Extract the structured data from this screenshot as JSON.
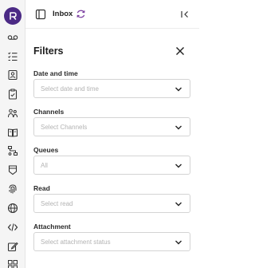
{
  "header": {
    "title": "Inbox"
  },
  "filters": {
    "title": "Filters",
    "fields": [
      {
        "label": "Date and time",
        "placeholder": "Select date and time"
      },
      {
        "label": "Channels",
        "placeholder": "Select Channels"
      },
      {
        "label": "Queues",
        "placeholder": "All"
      },
      {
        "label": "Read",
        "placeholder": "Select read"
      },
      {
        "label": "Attachment",
        "placeholder": "Select attachment status"
      }
    ]
  },
  "sidebar": {
    "icons": [
      "voicemail-icon",
      "list-checks-icon",
      "contact-card-icon",
      "clipboard-icon",
      "users-icon",
      "book-icon",
      "workflow-icon",
      "database-icon",
      "fingerprint-icon",
      "globe-icon",
      "code-icon",
      "edit-icon",
      "grid-icon"
    ]
  },
  "colors": {
    "brand": "#4b2a85",
    "refresh_accent": "#7b3fa0"
  }
}
